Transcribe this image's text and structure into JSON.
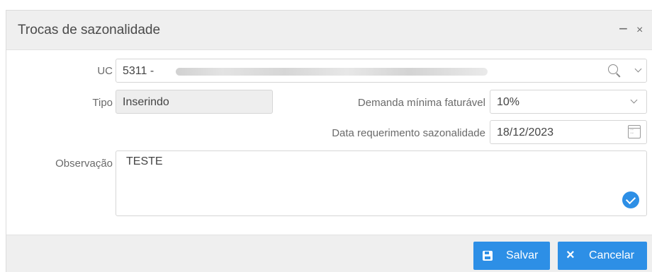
{
  "dialog": {
    "title": "Trocas de sazonalidade",
    "minimize_glyph": "−",
    "close_glyph": "×"
  },
  "form": {
    "uc": {
      "label": "UC",
      "value": "5311  -",
      "icons": [
        "search-icon",
        "chevron-down-icon"
      ]
    },
    "tipo": {
      "label": "Tipo",
      "value": "Inserindo"
    },
    "demanda": {
      "label": "Demanda mínima faturável",
      "value": "10%",
      "icon": "chevron-down-icon"
    },
    "data_requerimento": {
      "label": "Data requerimento sazonalidade",
      "value": "18/12/2023",
      "icon": "calendar-icon"
    },
    "observacao": {
      "label": "Observação",
      "value": "TESTE",
      "icon": "check-circle-icon"
    }
  },
  "footer": {
    "save_label": "Salvar",
    "cancel_label": "Cancelar",
    "cancel_glyph": "×"
  },
  "colors": {
    "accent": "#2d8fe6",
    "titlebar_bg": "#efefef",
    "readonly_bg": "#eeeeee",
    "border": "#d6d6d6"
  }
}
